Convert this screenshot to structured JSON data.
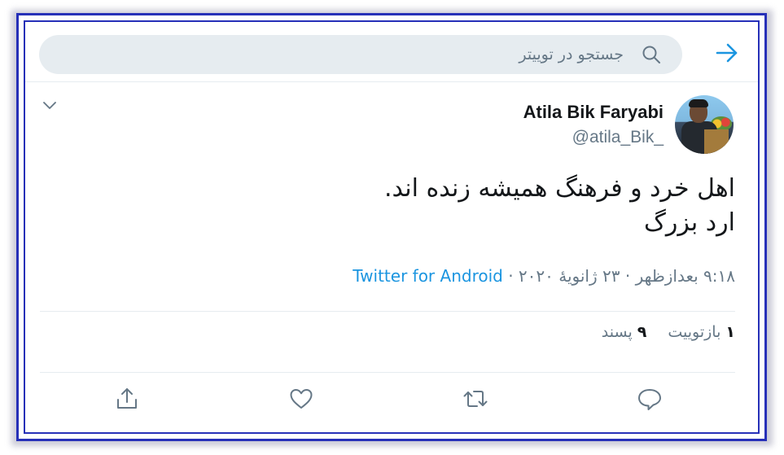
{
  "search": {
    "placeholder": "جستجو در توییتر"
  },
  "tweet": {
    "display_name": "Atila Bik Faryabi",
    "handle": "@atila_Bik_",
    "text_lines": [
      "اهل خرد و فرهنگ همیشه زنده اند.",
      "ارد بزرگ"
    ],
    "timestamp": "۹:۱۸ بعدازظهر · ۲۳ ژانویهٔ ۲۰۲۰ · ",
    "source": "Twitter for Android",
    "stats": {
      "retweets_count": "۱",
      "retweets_label": "بازتوییت",
      "likes_count": "۹",
      "likes_label": "پسند"
    }
  },
  "icons": {
    "back": "arrow-right-icon",
    "search": "search-icon",
    "caret": "chevron-down-icon",
    "reply": "reply-icon",
    "retweet": "retweet-icon",
    "like": "heart-icon",
    "share": "share-icon"
  },
  "colors": {
    "accent": "#1b95e0",
    "frame": "#2630b8",
    "secondary_text": "#657786",
    "search_bg": "#e6ecf0"
  }
}
